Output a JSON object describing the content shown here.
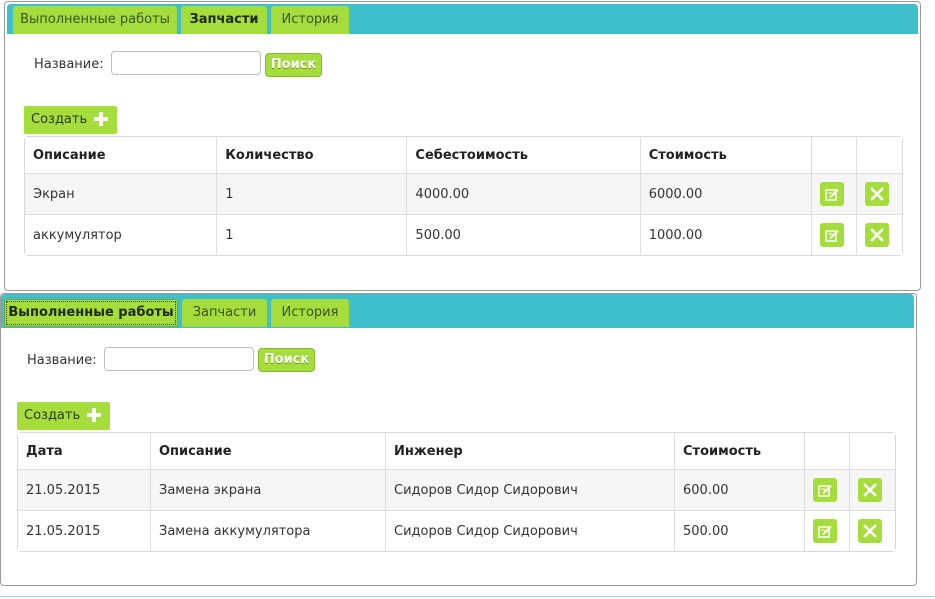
{
  "panel_parts": {
    "tabs": [
      "Выполненные работы",
      "Запчасти",
      "История"
    ],
    "active_tab": 1,
    "search_label": "Название:",
    "search_value": "",
    "search_button": "Поиск",
    "create_button": "Создать",
    "columns": [
      "Описание",
      "Количество",
      "Себестоимость",
      "Стоимость"
    ],
    "rows": [
      [
        "Экран",
        "1",
        "4000.00",
        "6000.00"
      ],
      [
        "аккумулятор",
        "1",
        "500.00",
        "1000.00"
      ]
    ]
  },
  "panel_works": {
    "tabs": [
      "Выполненные работы",
      "Запчасти",
      "История"
    ],
    "active_tab": 0,
    "search_label": "Название:",
    "search_value": "",
    "search_button": "Поиск",
    "create_button": "Создать",
    "columns": [
      "Дата",
      "Описание",
      "Инженер",
      "Стоимость"
    ],
    "rows": [
      [
        "21.05.2015",
        "Замена экрана",
        "Сидоров Сидор Сидорович",
        "600.00"
      ],
      [
        "21.05.2015",
        "Замена аккумулятора",
        "Сидоров Сидор Сидорович",
        "500.00"
      ]
    ]
  },
  "icons": {
    "edit": "edit-icon",
    "delete": "delete-icon"
  },
  "colors": {
    "tabbar": "#3fbecb",
    "accent_green": "#a5dd3c",
    "row_alt": "#f6f6f6"
  }
}
